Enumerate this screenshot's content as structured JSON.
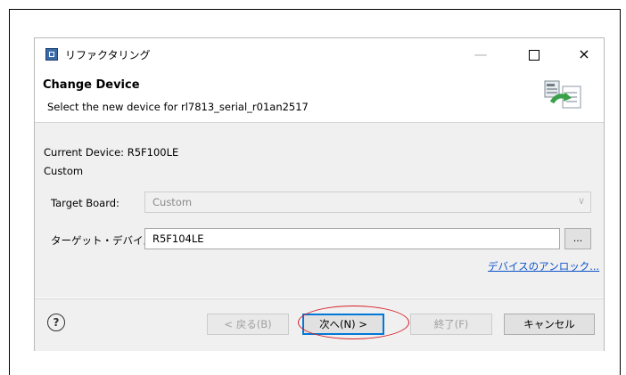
{
  "window": {
    "title": "リファクタリング",
    "minimize": "—",
    "close": "×"
  },
  "header": {
    "title": "Change Device",
    "description": "Select the new device for rl7813_serial_r01an2517"
  },
  "body": {
    "current_device": "Current Device: R5F100LE",
    "current_board": "Custom",
    "target_board_label": "Target Board:",
    "target_board_value": "Custom",
    "target_device_label": "ターゲット・デバイス:",
    "target_device_value": "R5F104LE",
    "browse_label": "...",
    "unlock_link": "デバイスのアンロック..."
  },
  "footer": {
    "help": "?",
    "back": "< 戻る(B)",
    "next": "次へ(N) >",
    "finish": "終了(F)",
    "cancel": "キャンセル"
  },
  "colors": {
    "highlight": "#d71f27",
    "focus": "#0078d7",
    "link": "#0b52c9"
  }
}
